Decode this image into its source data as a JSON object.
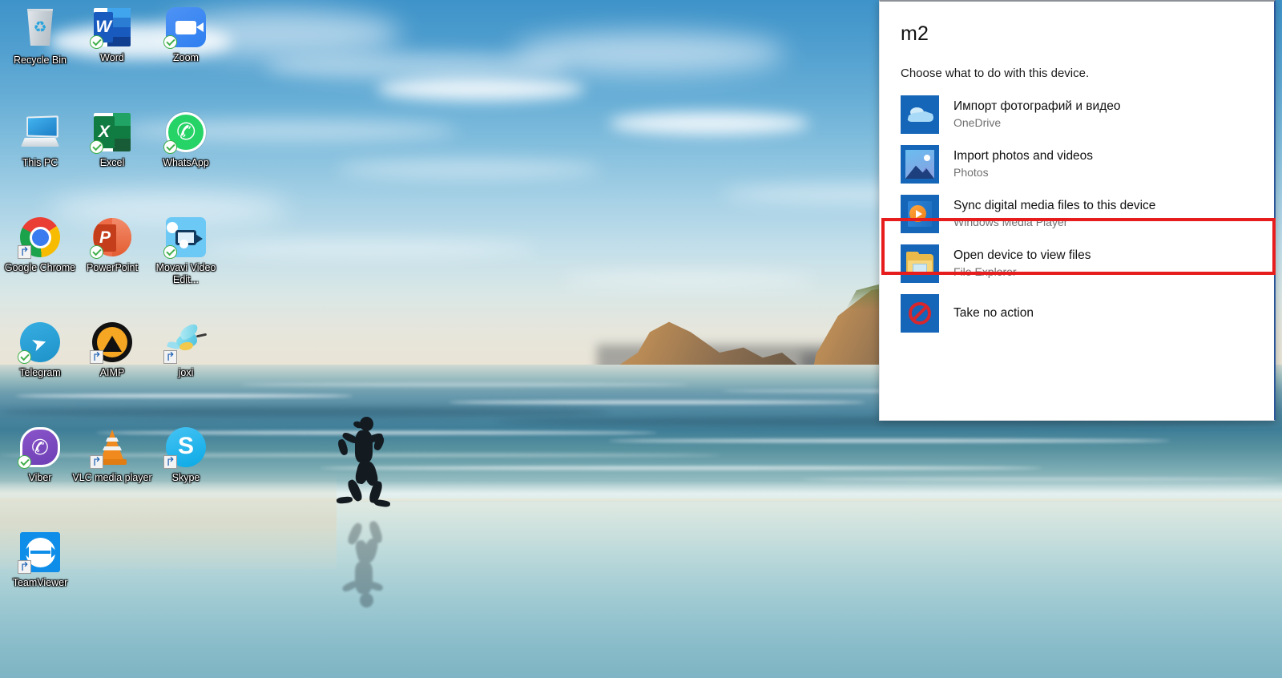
{
  "desktop": {
    "icons": [
      {
        "label": "Recycle Bin",
        "art": "bin",
        "badge": "none"
      },
      {
        "label": "Word",
        "art": "word",
        "badge": "check"
      },
      {
        "label": "Zoom",
        "art": "zoom",
        "badge": "check"
      },
      {
        "label": "This PC",
        "art": "pc",
        "badge": "none"
      },
      {
        "label": "Excel",
        "art": "excel",
        "badge": "check"
      },
      {
        "label": "WhatsApp",
        "art": "wa",
        "badge": "check"
      },
      {
        "label": "Google Chrome",
        "art": "chrome",
        "badge": "shortcut"
      },
      {
        "label": "PowerPoint",
        "art": "ppt",
        "badge": "check"
      },
      {
        "label": "Movavi Video Edit...",
        "art": "mov",
        "badge": "check"
      },
      {
        "label": "Telegram",
        "art": "tg",
        "badge": "check"
      },
      {
        "label": "AIMP",
        "art": "aimp",
        "badge": "shortcut"
      },
      {
        "label": "joxi",
        "art": "joxi",
        "badge": "shortcut"
      },
      {
        "label": "Viber",
        "art": "viber",
        "badge": "check"
      },
      {
        "label": "VLC media player",
        "art": "vlc",
        "badge": "shortcut"
      },
      {
        "label": "Skype",
        "art": "skype",
        "badge": "shortcut"
      },
      {
        "label": "TeamViewer",
        "art": "tv",
        "badge": "shortcut"
      }
    ]
  },
  "autoplay": {
    "device_name": "m2",
    "prompt": "Choose what to do with this device.",
    "highlight_color": "#e71d1d",
    "highlighted_index": 2,
    "options": [
      {
        "primary": "Импорт фотографий и видео",
        "secondary": "OneDrive",
        "icon": "onedrive-icon"
      },
      {
        "primary": "Import photos and videos",
        "secondary": "Photos",
        "icon": "photos-icon"
      },
      {
        "primary": "Sync digital media files to this device",
        "secondary": "Windows Media Player",
        "icon": "windows-media-player-icon"
      },
      {
        "primary": "Open device to view files",
        "secondary": "File Explorer",
        "icon": "file-explorer-icon"
      },
      {
        "primary": "Take no action",
        "secondary": "",
        "icon": "no-action-icon"
      }
    ]
  }
}
